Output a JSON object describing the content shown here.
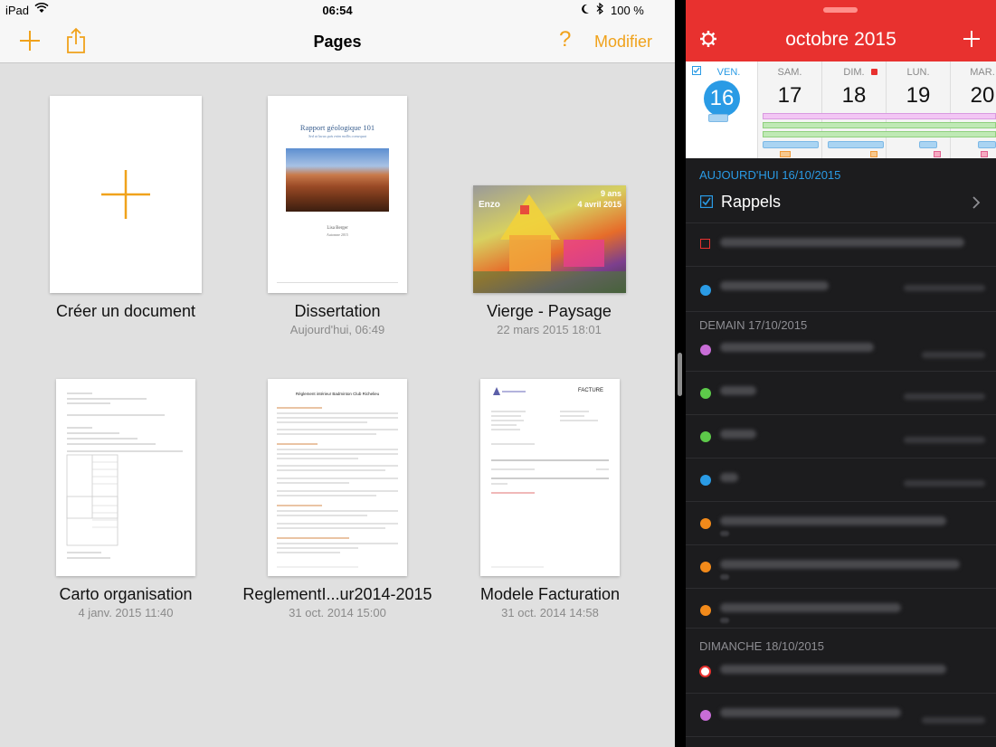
{
  "status": {
    "carrier": "iPad",
    "time": "06:54",
    "battery": "100 %"
  },
  "pages": {
    "title": "Pages",
    "edit_label": "Modifier",
    "help_label": "?",
    "accent": "#f0a21b",
    "documents": [
      {
        "name": "Créer un document",
        "date": ""
      },
      {
        "name": "Dissertation",
        "date": "Aujourd'hui, 06:49",
        "thumb_title": "Rapport géologique 101",
        "thumb_subtitle": "Sed ut lacus quis enim mollis consequat",
        "thumb_author": "Lisa Berger",
        "thumb_footer": "Automne 2015"
      },
      {
        "name": "Vierge - Paysage",
        "date": "22 mars 2015 18:01",
        "thumb_name": "Enzo",
        "thumb_age": "9 ans",
        "thumb_day": "4 avril 2015"
      },
      {
        "name": "Carto organisation",
        "date": "4 janv. 2015 11:40"
      },
      {
        "name": "ReglementI...ur2014-2015",
        "date": "31 oct. 2014 15:00",
        "thumb_title": "Règlement intérieur Badminton Club Richelieu"
      },
      {
        "name": "Modele Facturation",
        "date": "31 oct. 2014 14:58",
        "thumb_title": "FACTURE"
      }
    ]
  },
  "calendar": {
    "month_title": "octobre 2015",
    "header_color": "#e8312f",
    "days": [
      {
        "name": "VEN.",
        "num": "16",
        "today": true
      },
      {
        "name": "SAM.",
        "num": "17"
      },
      {
        "name": "DIM.",
        "num": "18"
      },
      {
        "name": "LUN.",
        "num": "19"
      },
      {
        "name": "MAR.",
        "num": "20"
      }
    ],
    "sections": [
      {
        "header": "AUJOURD'HUI 16/10/2015"
      },
      {
        "header": "DEMAIN 17/10/2015"
      },
      {
        "header": "DIMANCHE 18/10/2015"
      }
    ],
    "reminders_label": "Rappels"
  }
}
